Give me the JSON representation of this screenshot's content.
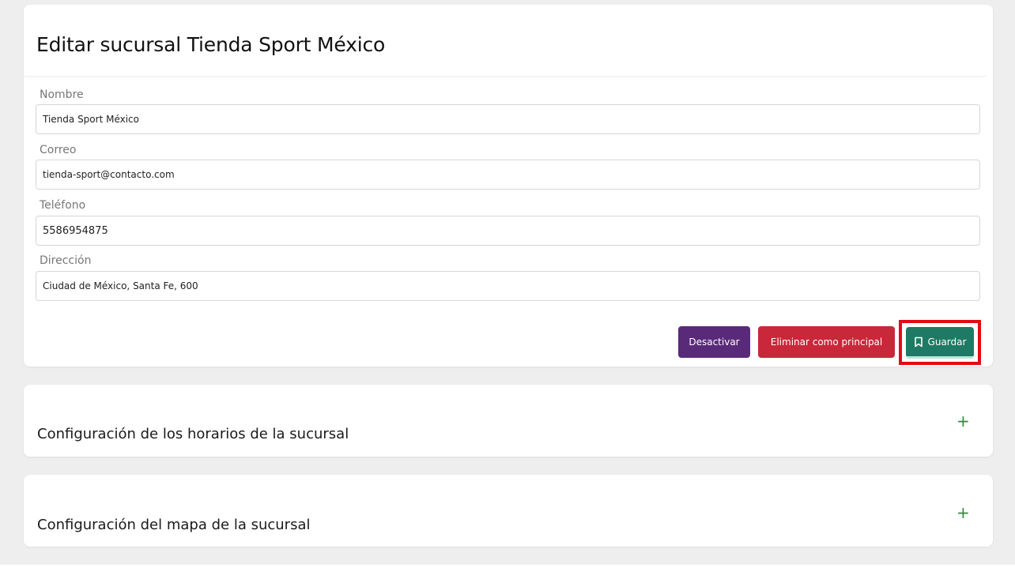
{
  "title": "Editar sucursal Tienda Sport México",
  "form": {
    "fields": [
      {
        "label": "Nombre",
        "value": "Tienda Sport México"
      },
      {
        "label": "Correo",
        "value": "tienda-sport@contacto.com"
      },
      {
        "label": "Teléfono",
        "value": "5586954875"
      },
      {
        "label": "Dirección",
        "value": "Ciudad de México, Santa Fe, 600"
      }
    ]
  },
  "actions": {
    "deactivate_label": "Desactivar",
    "remove_primary_label": "Eliminar como principal",
    "save_label": "Guardar",
    "save_icon": "bookmark-icon"
  },
  "sections": [
    {
      "title": "Configuración de los horarios de la sucursal",
      "toggle": "+"
    },
    {
      "title": "Configuración del mapa de la sucursal",
      "toggle": "+"
    }
  ],
  "colors": {
    "deactivate": "#5a2a7a",
    "remove_primary": "#c8283a",
    "save": "#1e7a64",
    "highlight": "#e30b12",
    "expand_icon": "#2e8b3a"
  }
}
